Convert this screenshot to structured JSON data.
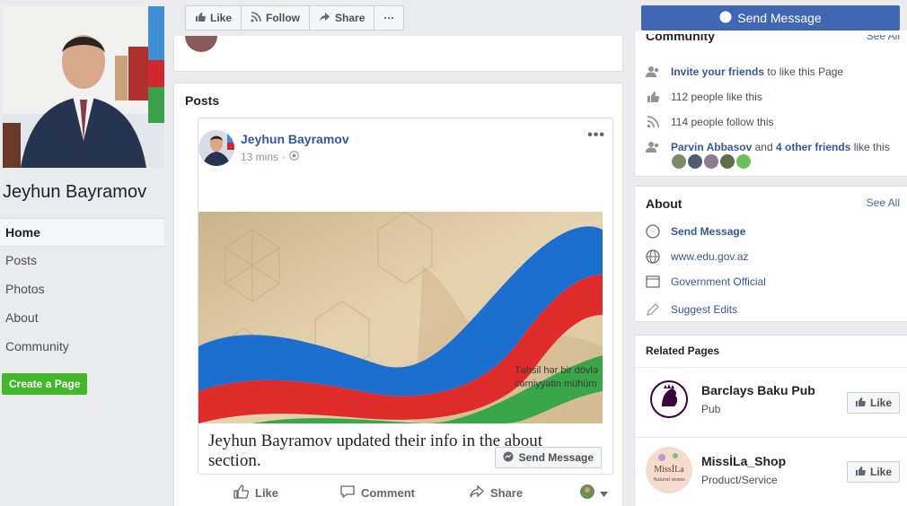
{
  "left": {
    "page_name": "Jeyhun Bayramov",
    "nav": [
      {
        "label": "Home",
        "active": true
      },
      {
        "label": "Posts",
        "active": false
      },
      {
        "label": "Photos",
        "active": false
      },
      {
        "label": "About",
        "active": false
      },
      {
        "label": "Community",
        "active": false
      }
    ],
    "create_page": "Create a Page"
  },
  "actionbar": {
    "like": "Like",
    "follow": "Follow",
    "share": "Share",
    "more": "···"
  },
  "posts": {
    "title": "Posts",
    "author": "Jeyhun Bayramov",
    "time": "13 mins",
    "time_sep": "·",
    "menu": "•••",
    "image_caption_line1": "Təhsil hər bir dövlə",
    "image_caption_line2": "cəmiyyətin mühüm",
    "text": "Jeyhun Bayramov updated their info in the about section.",
    "send_message": "Send Message",
    "actions": {
      "like": "Like",
      "comment": "Comment",
      "share": "Share"
    }
  },
  "right": {
    "send_message": "Send Message",
    "community": {
      "title": "Community",
      "see_all": "See All",
      "invite_link": "Invite your friends",
      "invite_rest": "to like this Page",
      "likes": "112 people like this",
      "follows": "114 people follow this",
      "friend_name": "Parvin Abbasov",
      "friend_and": "and",
      "friend_others": "4 other friends",
      "friend_rest": "like this"
    },
    "about": {
      "title": "About",
      "see_all": "See All",
      "send_message": "Send Message",
      "website": "www.edu.gov.az",
      "category": "Government Official",
      "suggest": "Suggest Edits"
    },
    "related": {
      "title": "Related Pages",
      "items": [
        {
          "name": "Barclays Baku Pub",
          "category": "Pub",
          "like": "Like"
        },
        {
          "name": "MissİLa_Shop",
          "category": "Product/Service",
          "like": "Like",
          "logo_text": "MissİLa",
          "logo_sub": "Natural stones"
        }
      ]
    }
  },
  "colors": {
    "brand_blue": "#4267b2",
    "link_blue": "#365899",
    "create_green": "#42b72a"
  }
}
